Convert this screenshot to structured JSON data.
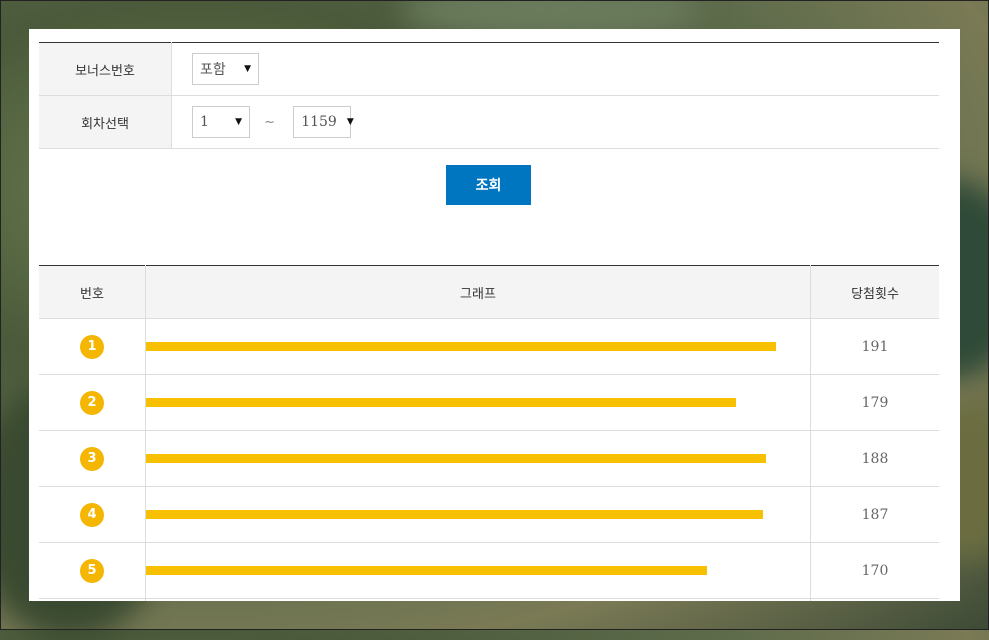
{
  "filters": {
    "bonus": {
      "label": "보너스번호",
      "selected": "포함"
    },
    "round": {
      "label": "회차선택",
      "from": "1",
      "separator": "~",
      "to": "1159"
    }
  },
  "search_button": "조회",
  "results": {
    "headers": {
      "number": "번호",
      "graph": "그래프",
      "count": "당첨횟수"
    },
    "rows": [
      {
        "number": "1",
        "count": "191",
        "value": 191
      },
      {
        "number": "2",
        "count": "179",
        "value": 179
      },
      {
        "number": "3",
        "count": "188",
        "value": 188
      },
      {
        "number": "4",
        "count": "187",
        "value": 187
      },
      {
        "number": "5",
        "count": "170",
        "value": 170
      }
    ]
  },
  "colors": {
    "accent": "#0076c0",
    "ball": "#f4b600",
    "bar": "#f7c000"
  }
}
